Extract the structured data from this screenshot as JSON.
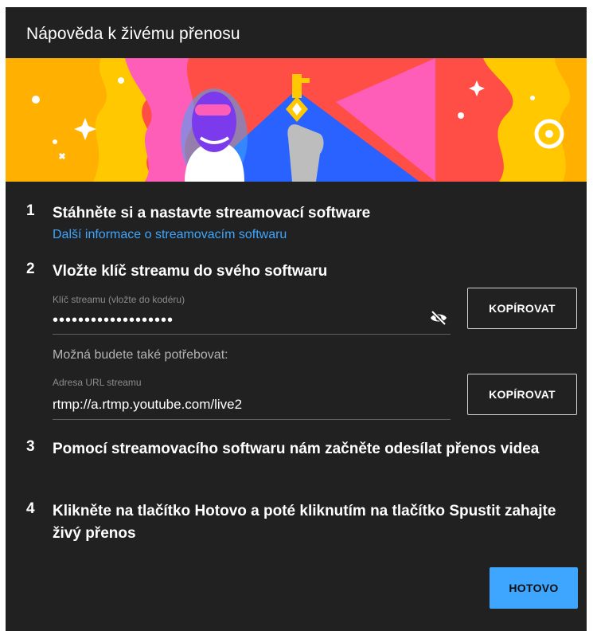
{
  "dialog": {
    "title": "Nápověda k živému přenosu"
  },
  "steps": [
    {
      "number": "1",
      "title": "Stáhněte si a nastavte streamovací software",
      "link": "Další informace o streamovacím softwaru"
    },
    {
      "number": "2",
      "title": "Vložte klíč streamu do svého softwaru"
    },
    {
      "number": "3",
      "title": "Pomocí streamovacího softwaru nám začněte odesílat přenos videa"
    },
    {
      "number": "4",
      "title": "Klikněte na tlačítko Hotovo a poté kliknutím na tlačítko Spustit zahajte živý přenos"
    }
  ],
  "stream_key": {
    "label": "Klíč streamu (vložte do kodéru)",
    "value": "•••••••••••••••••••",
    "visibility_icon": "eye-off-icon",
    "copy_label": "KOPÍROVAT"
  },
  "also_needed": "Možná budete také potřebovat:",
  "stream_url": {
    "label": "Adresa URL streamu",
    "value": "rtmp://a.rtmp.youtube.com/live2",
    "copy_label": "KOPÍROVAT"
  },
  "footer": {
    "done_label": "HOTOVO"
  },
  "colors": {
    "dialog_bg": "#212121",
    "link": "#3ea6ff",
    "primary_button": "#3ea6ff"
  }
}
